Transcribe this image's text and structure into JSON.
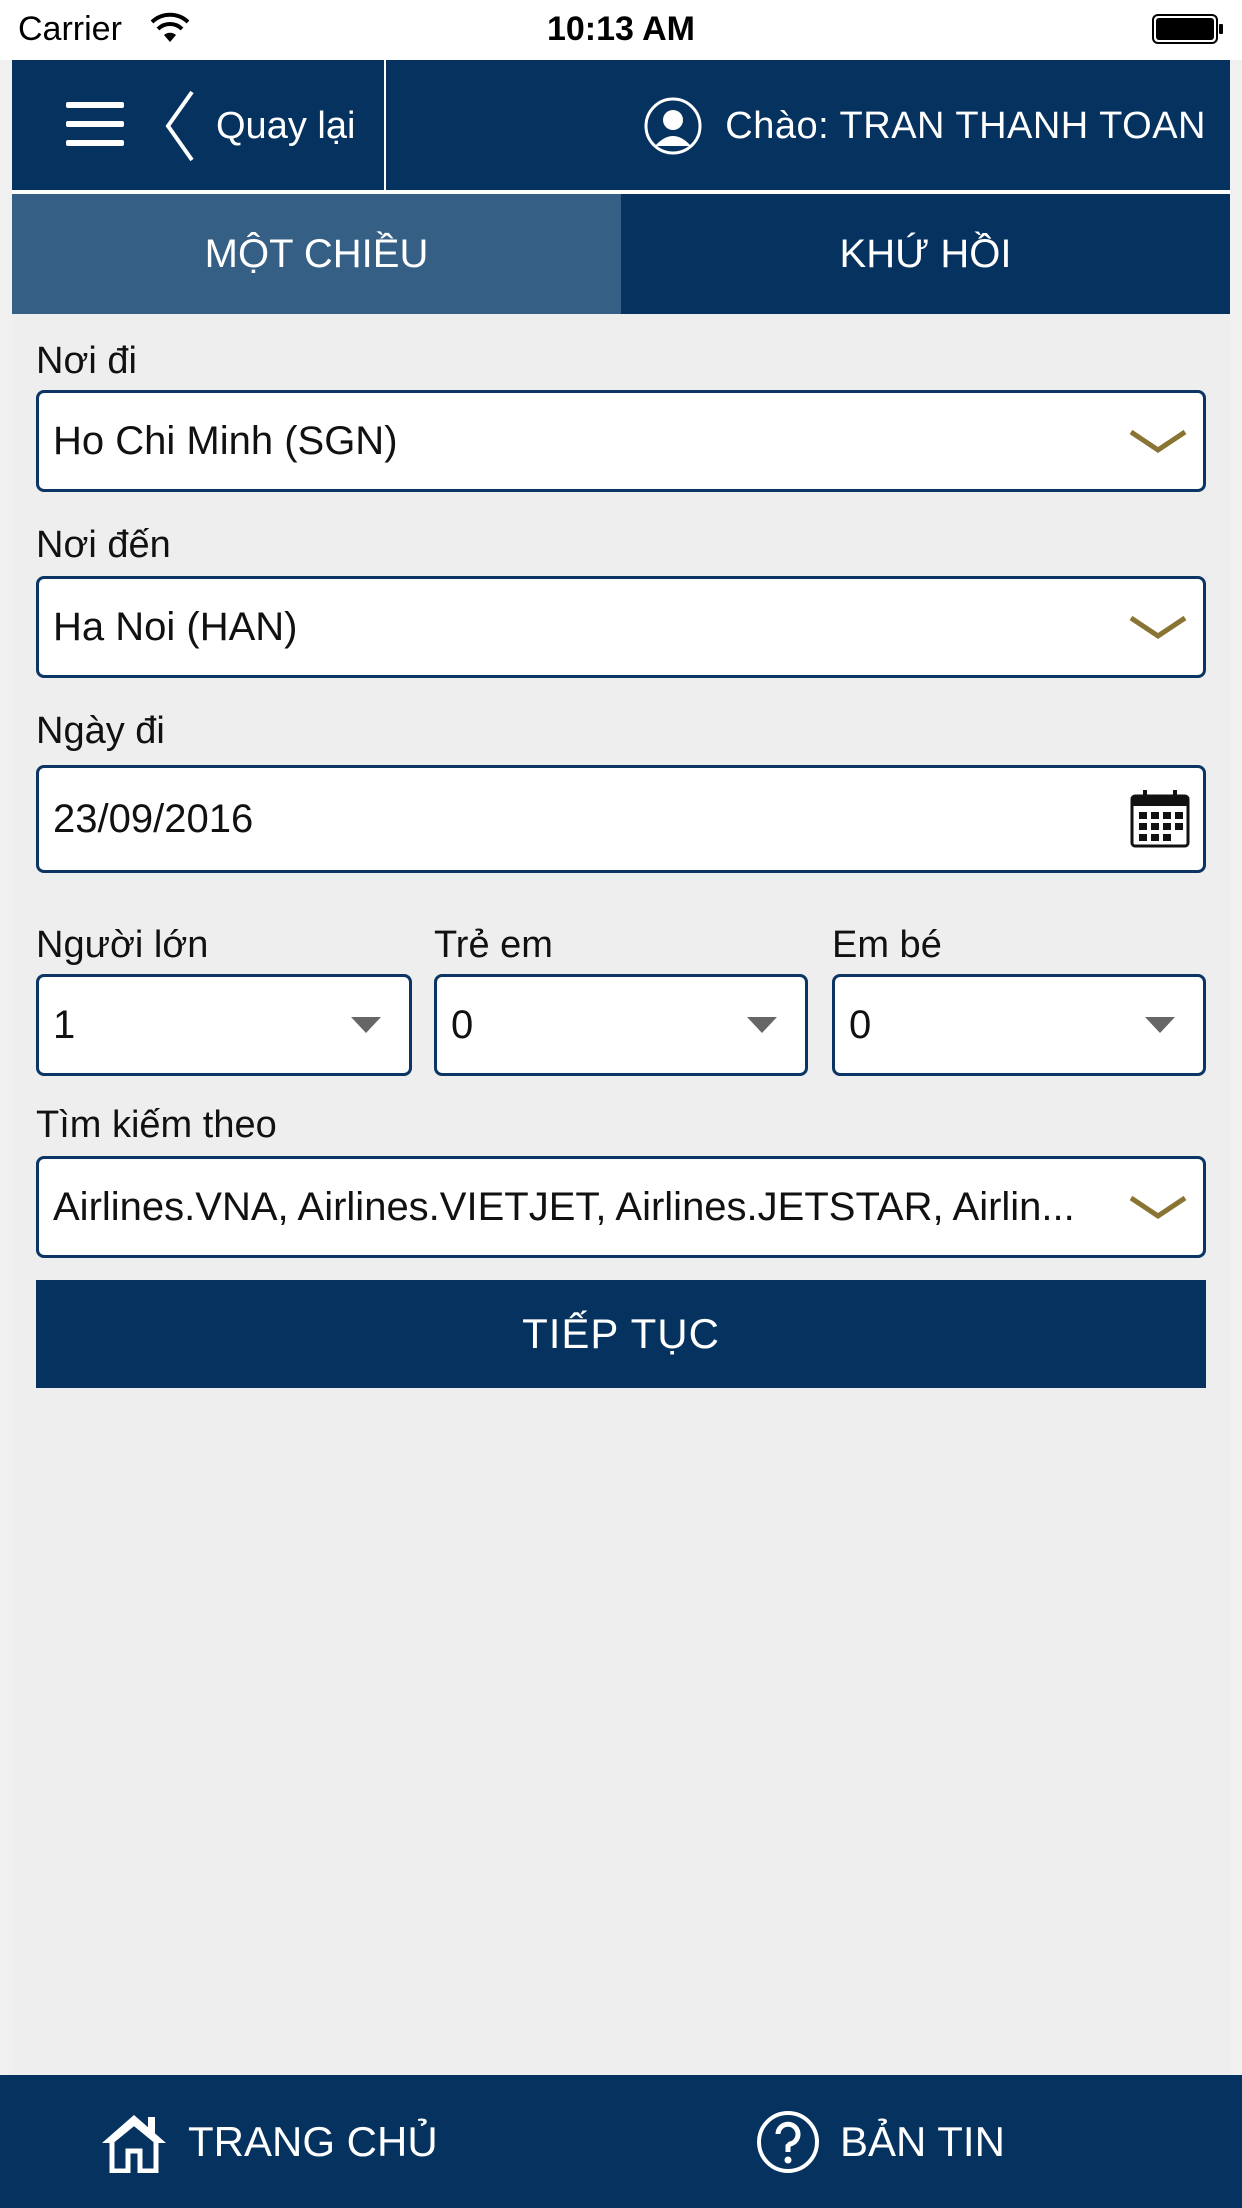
{
  "status_bar": {
    "carrier": "Carrier",
    "time": "10:13 AM"
  },
  "header": {
    "back_label": "Quay lại",
    "greeting": "Chào: TRAN THANH TOAN"
  },
  "tabs": [
    {
      "label": "MỘT CHIỀU",
      "active": true
    },
    {
      "label": "KHỨ HỒI",
      "active": false
    }
  ],
  "form": {
    "origin": {
      "label": "Nơi đi",
      "value": "Ho Chi Minh (SGN)"
    },
    "destination": {
      "label": "Nơi đến",
      "value": "Ha Noi (HAN)"
    },
    "depart_date": {
      "label": "Ngày đi",
      "value": "23/09/2016"
    },
    "adults": {
      "label": "Người lớn",
      "value": "1"
    },
    "children": {
      "label": "Trẻ em",
      "value": "0"
    },
    "infants": {
      "label": "Em bé",
      "value": "0"
    },
    "search_by": {
      "label": "Tìm kiếm theo",
      "value": "Airlines.VNA, Airlines.VIETJET, Airlines.JETSTAR, Airlin..."
    },
    "continue_label": "TIẾP TỤC"
  },
  "bottom_nav": {
    "home_label": "TRANG CHỦ",
    "news_label": "BẢN TIN"
  },
  "colors": {
    "navy": "#06325f",
    "active_tab": "#355f85",
    "accent_gold": "#8a7433",
    "background": "#eeeeee"
  },
  "icons": [
    "wifi-icon",
    "battery-icon",
    "menu-icon",
    "back-chevron-icon",
    "user-icon",
    "chevron-down-icon",
    "caret-down-icon",
    "calendar-icon",
    "home-icon",
    "help-icon"
  ]
}
